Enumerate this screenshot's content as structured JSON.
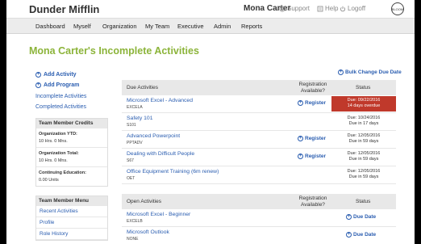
{
  "header": {
    "brand": "Dunder Mifflin",
    "user": "Mona Carter",
    "links": [
      "Support",
      "Help",
      "Logoff"
    ],
    "logo_text": "BLOOM"
  },
  "nav": [
    "Dashboard",
    "Myself",
    "Organization",
    "My Team",
    "Executive",
    "Admin",
    "Reports"
  ],
  "page_title": "Mona Carter's Incomplete Activities",
  "sidebar": {
    "actions": [
      "Add Activity",
      "Add Program"
    ],
    "links": [
      "Incomplete Activities",
      "Completed Activities"
    ],
    "credits": {
      "title": "Team Member Credits",
      "items": [
        {
          "label": "Organization YTD:",
          "value": "10 Hrs. 0 Mns."
        },
        {
          "label": "Organization Total:",
          "value": "10 Hrs. 0 Mns."
        },
        {
          "label": "Continuing Education:",
          "value": "0.00 Units"
        }
      ]
    },
    "menu": {
      "title": "Team Member Menu",
      "items": [
        "Recent Activities",
        "Profile",
        "Role History"
      ]
    }
  },
  "bulk_change": "Bulk Change Due Date",
  "due_table": {
    "col1": "Due Activities",
    "col2": "Registration Available?",
    "col3": "Status",
    "rows": [
      {
        "name": "Microsoft Excel - Advanced",
        "code": "EXCELA",
        "register": "Register",
        "status1": "Due: 09/22/2016",
        "status2": "14 days overdue",
        "overdue": true
      },
      {
        "name": "Safety 101",
        "code": "S101",
        "register": "",
        "status1": "Due: 10/24/2016",
        "status2": "Due in 17 days",
        "overdue": false
      },
      {
        "name": "Advanced Powerpoint",
        "code": "PPTADV",
        "register": "Register",
        "status1": "Due: 12/05/2016",
        "status2": "Due in 59 days",
        "overdue": false
      },
      {
        "name": "Dealing with Difficult People",
        "code": "S67",
        "register": "Register",
        "status1": "Due: 12/05/2016",
        "status2": "Due in 59 days",
        "overdue": false
      },
      {
        "name": "Office Equipment Training (6m renew)",
        "code": "OET",
        "register": "",
        "status1": "Due: 12/05/2016",
        "status2": "Due in 59 days",
        "overdue": false
      }
    ]
  },
  "open_table": {
    "col1": "Open Activities",
    "col2": "Registration Available?",
    "col3": "Status",
    "rows": [
      {
        "name": "Microsoft Excel - Beginner",
        "code": "EXCELB",
        "link": "Due Date"
      },
      {
        "name": "Microsoft Outlook",
        "code": "NONE",
        "link": "Due Date"
      }
    ]
  }
}
